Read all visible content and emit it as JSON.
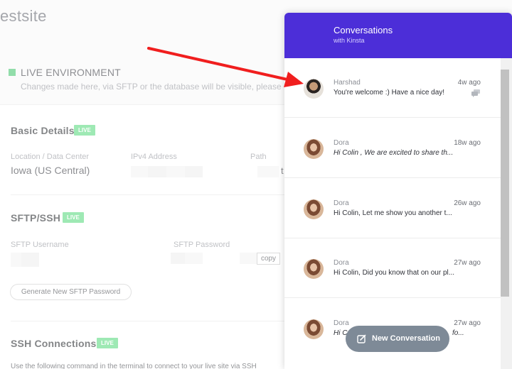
{
  "site": {
    "title": "estsite"
  },
  "environment": {
    "label": "LIVE ENVIRONMENT",
    "description": "Changes made here, via SFTP or the database will be visible, please",
    "status_color": "#3ac264"
  },
  "basic_details": {
    "title": "Basic Details",
    "badge": "LIVE",
    "location_label": "Location / Data Center",
    "location_value": "Iowa (US Central)",
    "ipv4_label": "IPv4 Address",
    "path_label": "Path",
    "path_value_fragment": "t"
  },
  "sftp": {
    "title": "SFTP/SSH",
    "badge": "LIVE",
    "username_label": "SFTP Username",
    "password_label": "SFTP Password",
    "copy_label": "copy",
    "generate_label": "Generate New SFTP Password"
  },
  "ssh": {
    "title": "SSH Connections",
    "badge": "LIVE",
    "instructions": "Use the following command in the terminal to connect to your live site via SSH"
  },
  "chat": {
    "title": "Conversations",
    "subtitle": "with Kinsta",
    "header_color": "#4c2ed8",
    "conversations": [
      {
        "name": "Harshad",
        "time": "4w ago",
        "message": "You're welcome :) Have a nice day!",
        "avatar_icon": "harshad-avatar",
        "italic": false,
        "seen": true
      },
      {
        "name": "Dora",
        "time": "18w ago",
        "message": "Hi Colin , We are excited to share th...",
        "avatar_icon": "dora-avatar",
        "italic": true,
        "seen": false
      },
      {
        "name": "Dora",
        "time": "26w ago",
        "message": "Hi Colin, Let me show you another t...",
        "avatar_icon": "dora-avatar",
        "italic": false,
        "seen": false
      },
      {
        "name": "Dora",
        "time": "27w ago",
        "message": "Hi Colin, Did you know that on our pl...",
        "avatar_icon": "dora-avatar",
        "italic": false,
        "seen": false
      },
      {
        "name": "Dora",
        "time": "27w ago",
        "message": "Hi C",
        "message_tail": "fo...",
        "avatar_icon": "dora-avatar",
        "italic": true,
        "seen": false
      }
    ],
    "new_conversation_label": "New Conversation"
  },
  "annotation": {
    "arrow_color": "#f01e1e",
    "arrow_icon": "red-arrow-icon"
  }
}
